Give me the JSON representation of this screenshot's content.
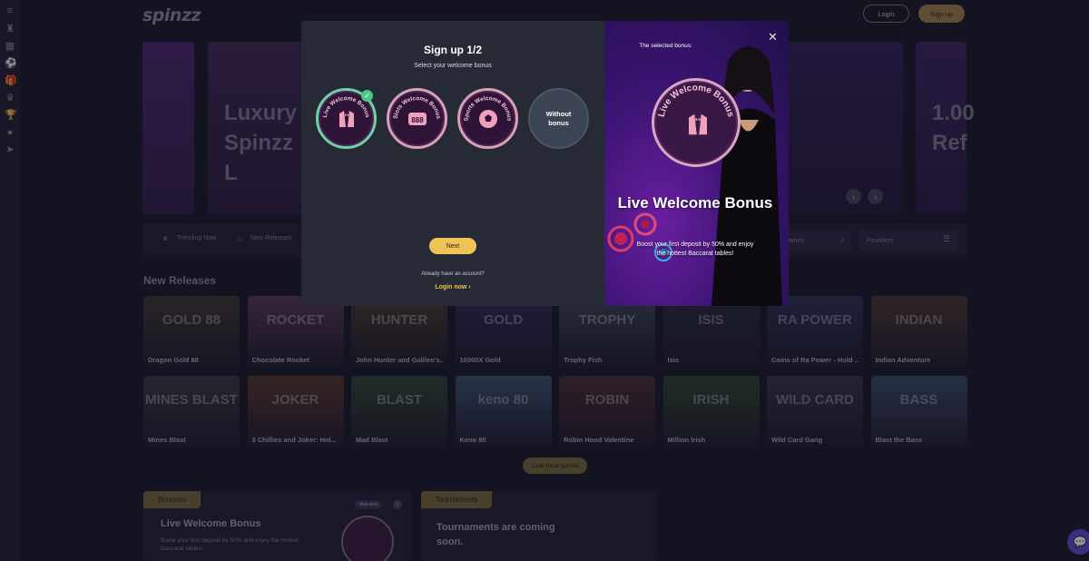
{
  "header": {
    "logo": "spinzz",
    "login_label": "Login",
    "signup_label": "Sign up"
  },
  "hero": {
    "banner_left_line1": "Luxury",
    "banner_left_line2": "Spinzz L",
    "banner_right_line1": "1.00",
    "banner_right_line2": "Ref"
  },
  "filters": {
    "trending": "Trending Now",
    "new_releases": "New Releases",
    "search_placeholder": "games",
    "providers": "Providers"
  },
  "games_section": {
    "title": "New Releases",
    "games": [
      {
        "title": "Dragon Gold 88",
        "art": "GOLD 88",
        "color": "#3f3a34"
      },
      {
        "title": "Chocolate Rocket",
        "art": "ROCKET",
        "color": "#5a3a55"
      },
      {
        "title": "John Hunter and Galileo's...",
        "art": "HUNTER",
        "color": "#4a3b2e"
      },
      {
        "title": "10000X Gold",
        "art": "GOLD",
        "color": "#2e2c57"
      },
      {
        "title": "Trophy Fish",
        "art": "TROPHY",
        "color": "#3b4a52"
      },
      {
        "title": "Isis",
        "art": "ISIS",
        "color": "#2a2e40"
      },
      {
        "title": "Coins of Ra Power - Hold ...",
        "art": "RA POWER",
        "color": "#2c3355"
      },
      {
        "title": "Indian Adventure",
        "art": "INDIAN",
        "color": "#4a3a30"
      },
      {
        "title": "Mines Blast",
        "art": "MINES BLAST",
        "color": "#3c3a3f"
      },
      {
        "title": "3 Chillies and Joker: Hol...",
        "art": "JOKER",
        "color": "#5a3a2f"
      },
      {
        "title": "Mad Blast",
        "art": "BLAST",
        "color": "#2f4a35"
      },
      {
        "title": "Keno 80",
        "art": "keno 80",
        "color": "#3d5570"
      },
      {
        "title": "Robin Hood Valentine",
        "art": "ROBIN",
        "color": "#4d2e35"
      },
      {
        "title": "Million Irish",
        "art": "IRISH",
        "color": "#2e4a30"
      },
      {
        "title": "Wild Card Gang",
        "art": "WILD CARD",
        "color": "#3a3548"
      },
      {
        "title": "Blast the Bass",
        "art": "BASS",
        "color": "#3a4f6a"
      }
    ],
    "load_more": "Load more games"
  },
  "promos": {
    "bonuses_tag": "Bonuses",
    "bonus_title": "Live Welcome Bonus",
    "bonus_desc": "Boost your first deposit by 50% and enjoy the hottest Baccarat tables!",
    "welcome_chip": "Welcome",
    "tournaments_tag": "Tournaments",
    "tournaments_title": "Tournaments are coming soon."
  },
  "modal": {
    "title": "Sign up 1/2",
    "subtitle": "Select your welcome bonus",
    "options": [
      {
        "label": "Live Welcome Bonus",
        "icon": "tuxedo-icon",
        "selected": true
      },
      {
        "label": "Slots Welcome Bonus",
        "icon": "slot-888-icon",
        "selected": false
      },
      {
        "label": "Sports Welcome Bonus",
        "icon": "soccer-ball-icon",
        "selected": false
      },
      {
        "label": "Without bonus",
        "icon": "",
        "selected": false
      }
    ],
    "without_bonus_line1": "Without",
    "without_bonus_line2": "bonus",
    "next_label": "Next",
    "already_text": "Already have an account?",
    "login_now": "Login now",
    "selected_label": "The selected bonus:",
    "selected_title": "Live Welcome Bonus",
    "selected_desc": "Boost your first deposit by 50% and enjoy the hottest Baccarat tables!",
    "selected_arc": "Live Welcome Bonus"
  },
  "colors": {
    "accent_gold": "#f0c356",
    "selected_green": "#4cc98a",
    "bonus_pink": "#d7a2b7"
  }
}
